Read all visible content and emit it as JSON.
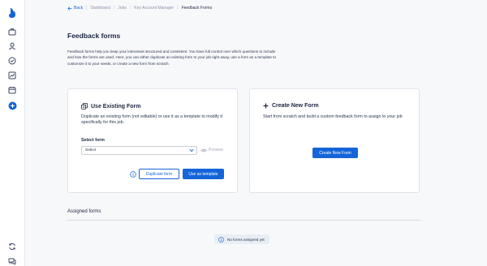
{
  "colors": {
    "accent": "#1565d8",
    "text": "#1a2540",
    "muted": "#8a93a6"
  },
  "breadcrumb": {
    "back": "Back",
    "items": [
      "Dashboard",
      "Jobs",
      "Key Account Manager",
      "Feedback Forms"
    ]
  },
  "page": {
    "title": "Feedback forms",
    "description": "Feedback forms help you keep your interviews structured and consistent. You have full control over which questions to include and how the forms are used. Here, you can either duplicate an existing form to your job right away, use a form as a template to customize it to your needs, or create a new form from scratch."
  },
  "use_existing": {
    "title": "Use Existing Form",
    "description": "Duplicate an existing form (not editable) or use it as a template to modify it specifically for this job.",
    "select_label": "Select form",
    "select_value": "Select",
    "preview": "Preview",
    "duplicate_button": "Duplicate form",
    "template_button": "Use as template"
  },
  "create_new": {
    "title": "Create New Form",
    "description": "Start from scratch and build a custom feedback form to assign to your job",
    "button": "Create New Form"
  },
  "assigned": {
    "title": "Assigned forms",
    "empty": "No forms assigned yet"
  },
  "sidebar": {
    "icons": [
      "briefcase-icon",
      "users-icon",
      "check-circle-icon",
      "analytics-icon",
      "calendar-icon",
      "add-circle-icon",
      "sync-icon",
      "chat-icon"
    ]
  }
}
